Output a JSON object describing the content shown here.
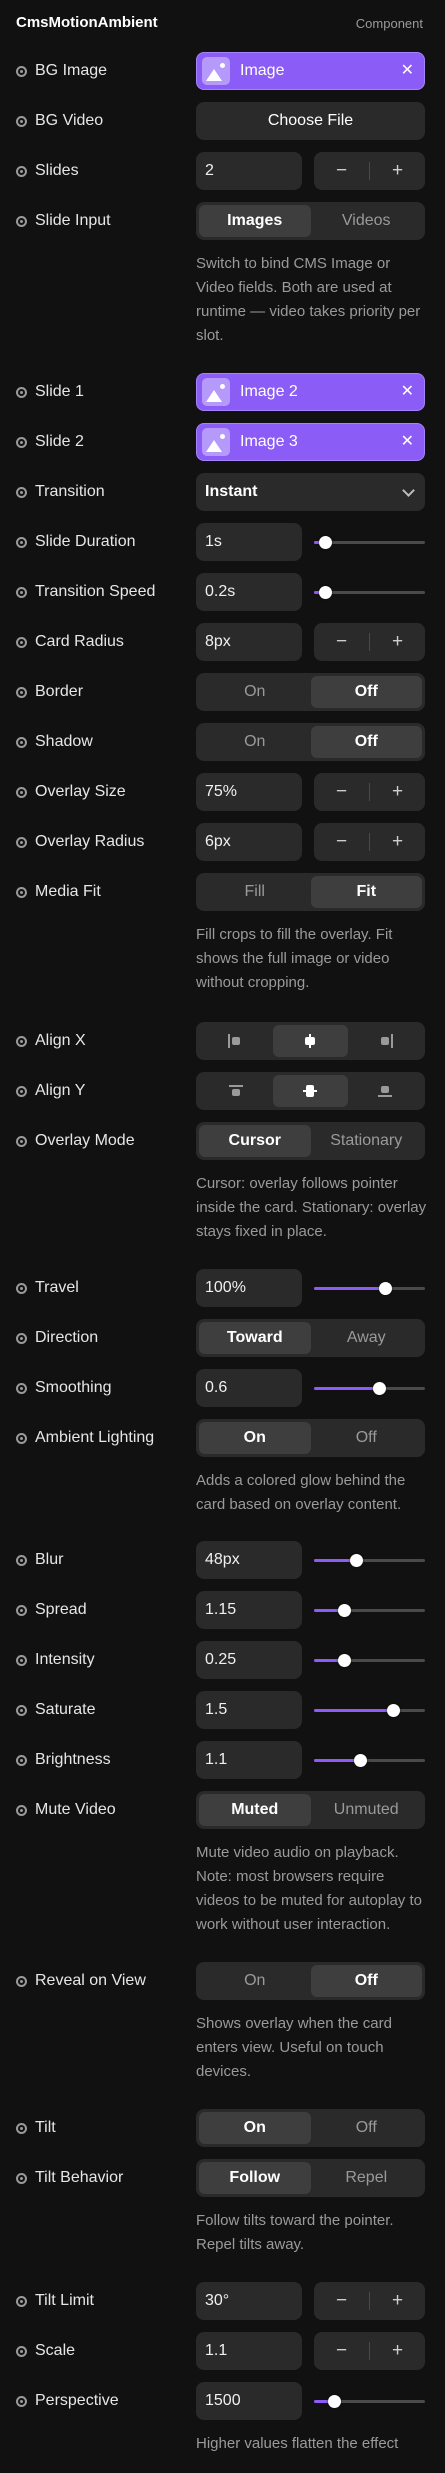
{
  "header": {
    "title": "CmsMotionAmbient",
    "tag": "Component"
  },
  "props": {
    "bg_image": {
      "label": "BG Image",
      "chip": "Image"
    },
    "bg_video": {
      "label": "BG Video",
      "button": "Choose File"
    },
    "slides": {
      "label": "Slides",
      "value": "2",
      "minus": "−",
      "plus": "+"
    },
    "slide_input": {
      "label": "Slide Input",
      "options": [
        "Images",
        "Videos"
      ],
      "selected": "Images",
      "help": "Switch to bind CMS Image or Video fields. Both are used at runtime — video takes priority per slot."
    },
    "slide_1": {
      "label": "Slide 1",
      "chip": "Image 2"
    },
    "slide_2": {
      "label": "Slide 2",
      "chip": "Image 3"
    },
    "transition": {
      "label": "Transition",
      "value": "Instant"
    },
    "slide_duration": {
      "label": "Slide Duration",
      "value": "1s",
      "slider_fraction": 0.1
    },
    "transition_speed": {
      "label": "Transition Speed",
      "value": "0.2s",
      "slider_fraction": 0.1
    },
    "card_radius": {
      "label": "Card Radius",
      "value": "8px",
      "minus": "−",
      "plus": "+"
    },
    "border": {
      "label": "Border",
      "options": [
        "On",
        "Off"
      ],
      "selected": "Off"
    },
    "shadow": {
      "label": "Shadow",
      "options": [
        "On",
        "Off"
      ],
      "selected": "Off"
    },
    "overlay_size": {
      "label": "Overlay Size",
      "value": "75%",
      "minus": "−",
      "plus": "+"
    },
    "overlay_radius": {
      "label": "Overlay Radius",
      "value": "6px",
      "minus": "−",
      "plus": "+"
    },
    "media_fit": {
      "label": "Media Fit",
      "options": [
        "Fill",
        "Fit"
      ],
      "selected": "Fit",
      "help": "Fill crops to fill the overlay. Fit shows the full image or video without cropping."
    },
    "align_x": {
      "label": "Align X",
      "options": [
        "align-left-icon",
        "align-center-h-icon",
        "align-right-icon"
      ],
      "selected": "align-center-h-icon"
    },
    "align_y": {
      "label": "Align Y",
      "options": [
        "align-top-icon",
        "align-center-v-icon",
        "align-bottom-icon"
      ],
      "selected": "align-center-v-icon"
    },
    "overlay_mode": {
      "label": "Overlay Mode",
      "options": [
        "Cursor",
        "Stationary"
      ],
      "selected": "Cursor",
      "help": "Cursor: overlay follows pointer inside the card. Stationary: overlay stays fixed in place."
    },
    "travel": {
      "label": "Travel",
      "value": "100%",
      "slider_fraction": 0.64
    },
    "direction": {
      "label": "Direction",
      "options": [
        "Toward",
        "Away"
      ],
      "selected": "Toward"
    },
    "smoothing": {
      "label": "Smoothing",
      "value": "0.6",
      "slider_fraction": 0.59
    },
    "ambient_lighting": {
      "label": "Ambient Lighting",
      "options": [
        "On",
        "Off"
      ],
      "selected": "On",
      "help": "Adds a colored glow behind the card based on overlay content."
    },
    "blur": {
      "label": "Blur",
      "value": "48px",
      "slider_fraction": 0.38
    },
    "spread": {
      "label": "Spread",
      "value": "1.15",
      "slider_fraction": 0.27
    },
    "intensity": {
      "label": "Intensity",
      "value": "0.25",
      "slider_fraction": 0.27
    },
    "saturate": {
      "label": "Saturate",
      "value": "1.5",
      "slider_fraction": 0.71
    },
    "brightness": {
      "label": "Brightness",
      "value": "1.1",
      "slider_fraction": 0.41
    },
    "mute_video": {
      "label": "Mute Video",
      "options": [
        "Muted",
        "Unmuted"
      ],
      "selected": "Muted",
      "help": "Mute video audio on playback. Note: most browsers require videos to be muted for autoplay to work without user interaction."
    },
    "reveal_on_view": {
      "label": "Reveal on View",
      "options": [
        "On",
        "Off"
      ],
      "selected": "Off",
      "help": "Shows overlay when the card enters view. Useful on touch devices."
    },
    "tilt": {
      "label": "Tilt",
      "options": [
        "On",
        "Off"
      ],
      "selected": "On"
    },
    "tilt_behavior": {
      "label": "Tilt Behavior",
      "options": [
        "Follow",
        "Repel"
      ],
      "selected": "Follow",
      "help": "Follow tilts toward the pointer. Repel tilts away."
    },
    "tilt_limit": {
      "label": "Tilt Limit",
      "value": "30°",
      "minus": "−",
      "plus": "+"
    },
    "scale": {
      "label": "Scale",
      "value": "1.1",
      "minus": "−",
      "plus": "+"
    },
    "perspective": {
      "label": "Perspective",
      "value": "1500",
      "slider_fraction": 0.18,
      "help": "Higher values flatten the effect"
    }
  },
  "colors": {
    "accent": "#8b5cf6",
    "background": "#111111",
    "control": "#2a2a2a"
  }
}
